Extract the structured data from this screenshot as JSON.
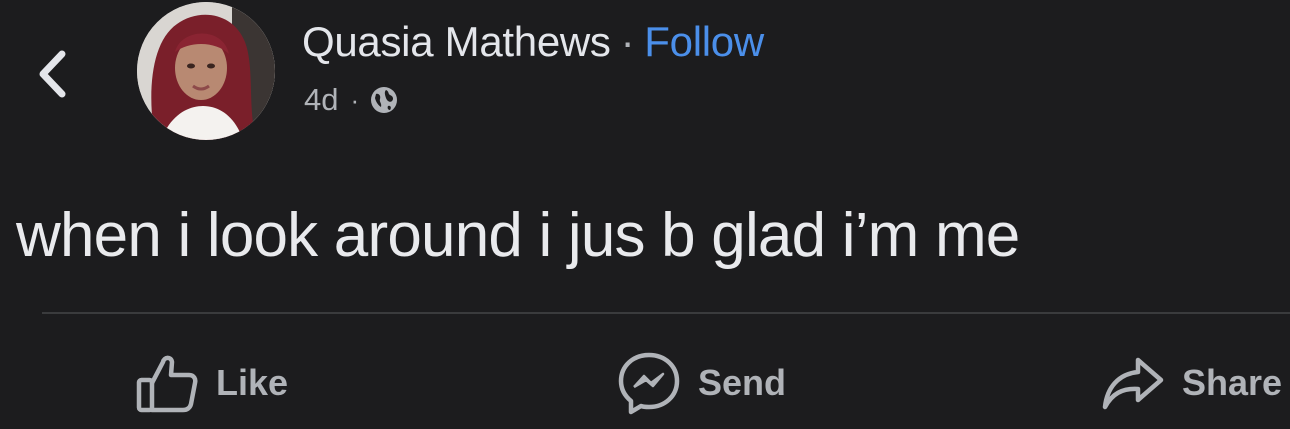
{
  "header": {
    "back_icon": "chevron-left-icon",
    "author_name": "Quasia Mathews",
    "separator": "·",
    "follow_label": "Follow",
    "timestamp": "4d",
    "meta_separator": "·",
    "audience_icon": "globe-icon"
  },
  "post": {
    "text": "when i look around i jus b glad i’m me"
  },
  "actions": {
    "like_label": "Like",
    "like_icon": "thumbs-up-icon",
    "send_label": "Send",
    "send_icon": "messenger-icon",
    "share_label": "Share",
    "share_icon": "share-arrow-icon"
  },
  "colors": {
    "background": "#1c1c1e",
    "text_primary": "#e4e6eb",
    "text_secondary": "#b0b3b8",
    "link": "#4b8fea",
    "divider": "#3a3b3d"
  }
}
